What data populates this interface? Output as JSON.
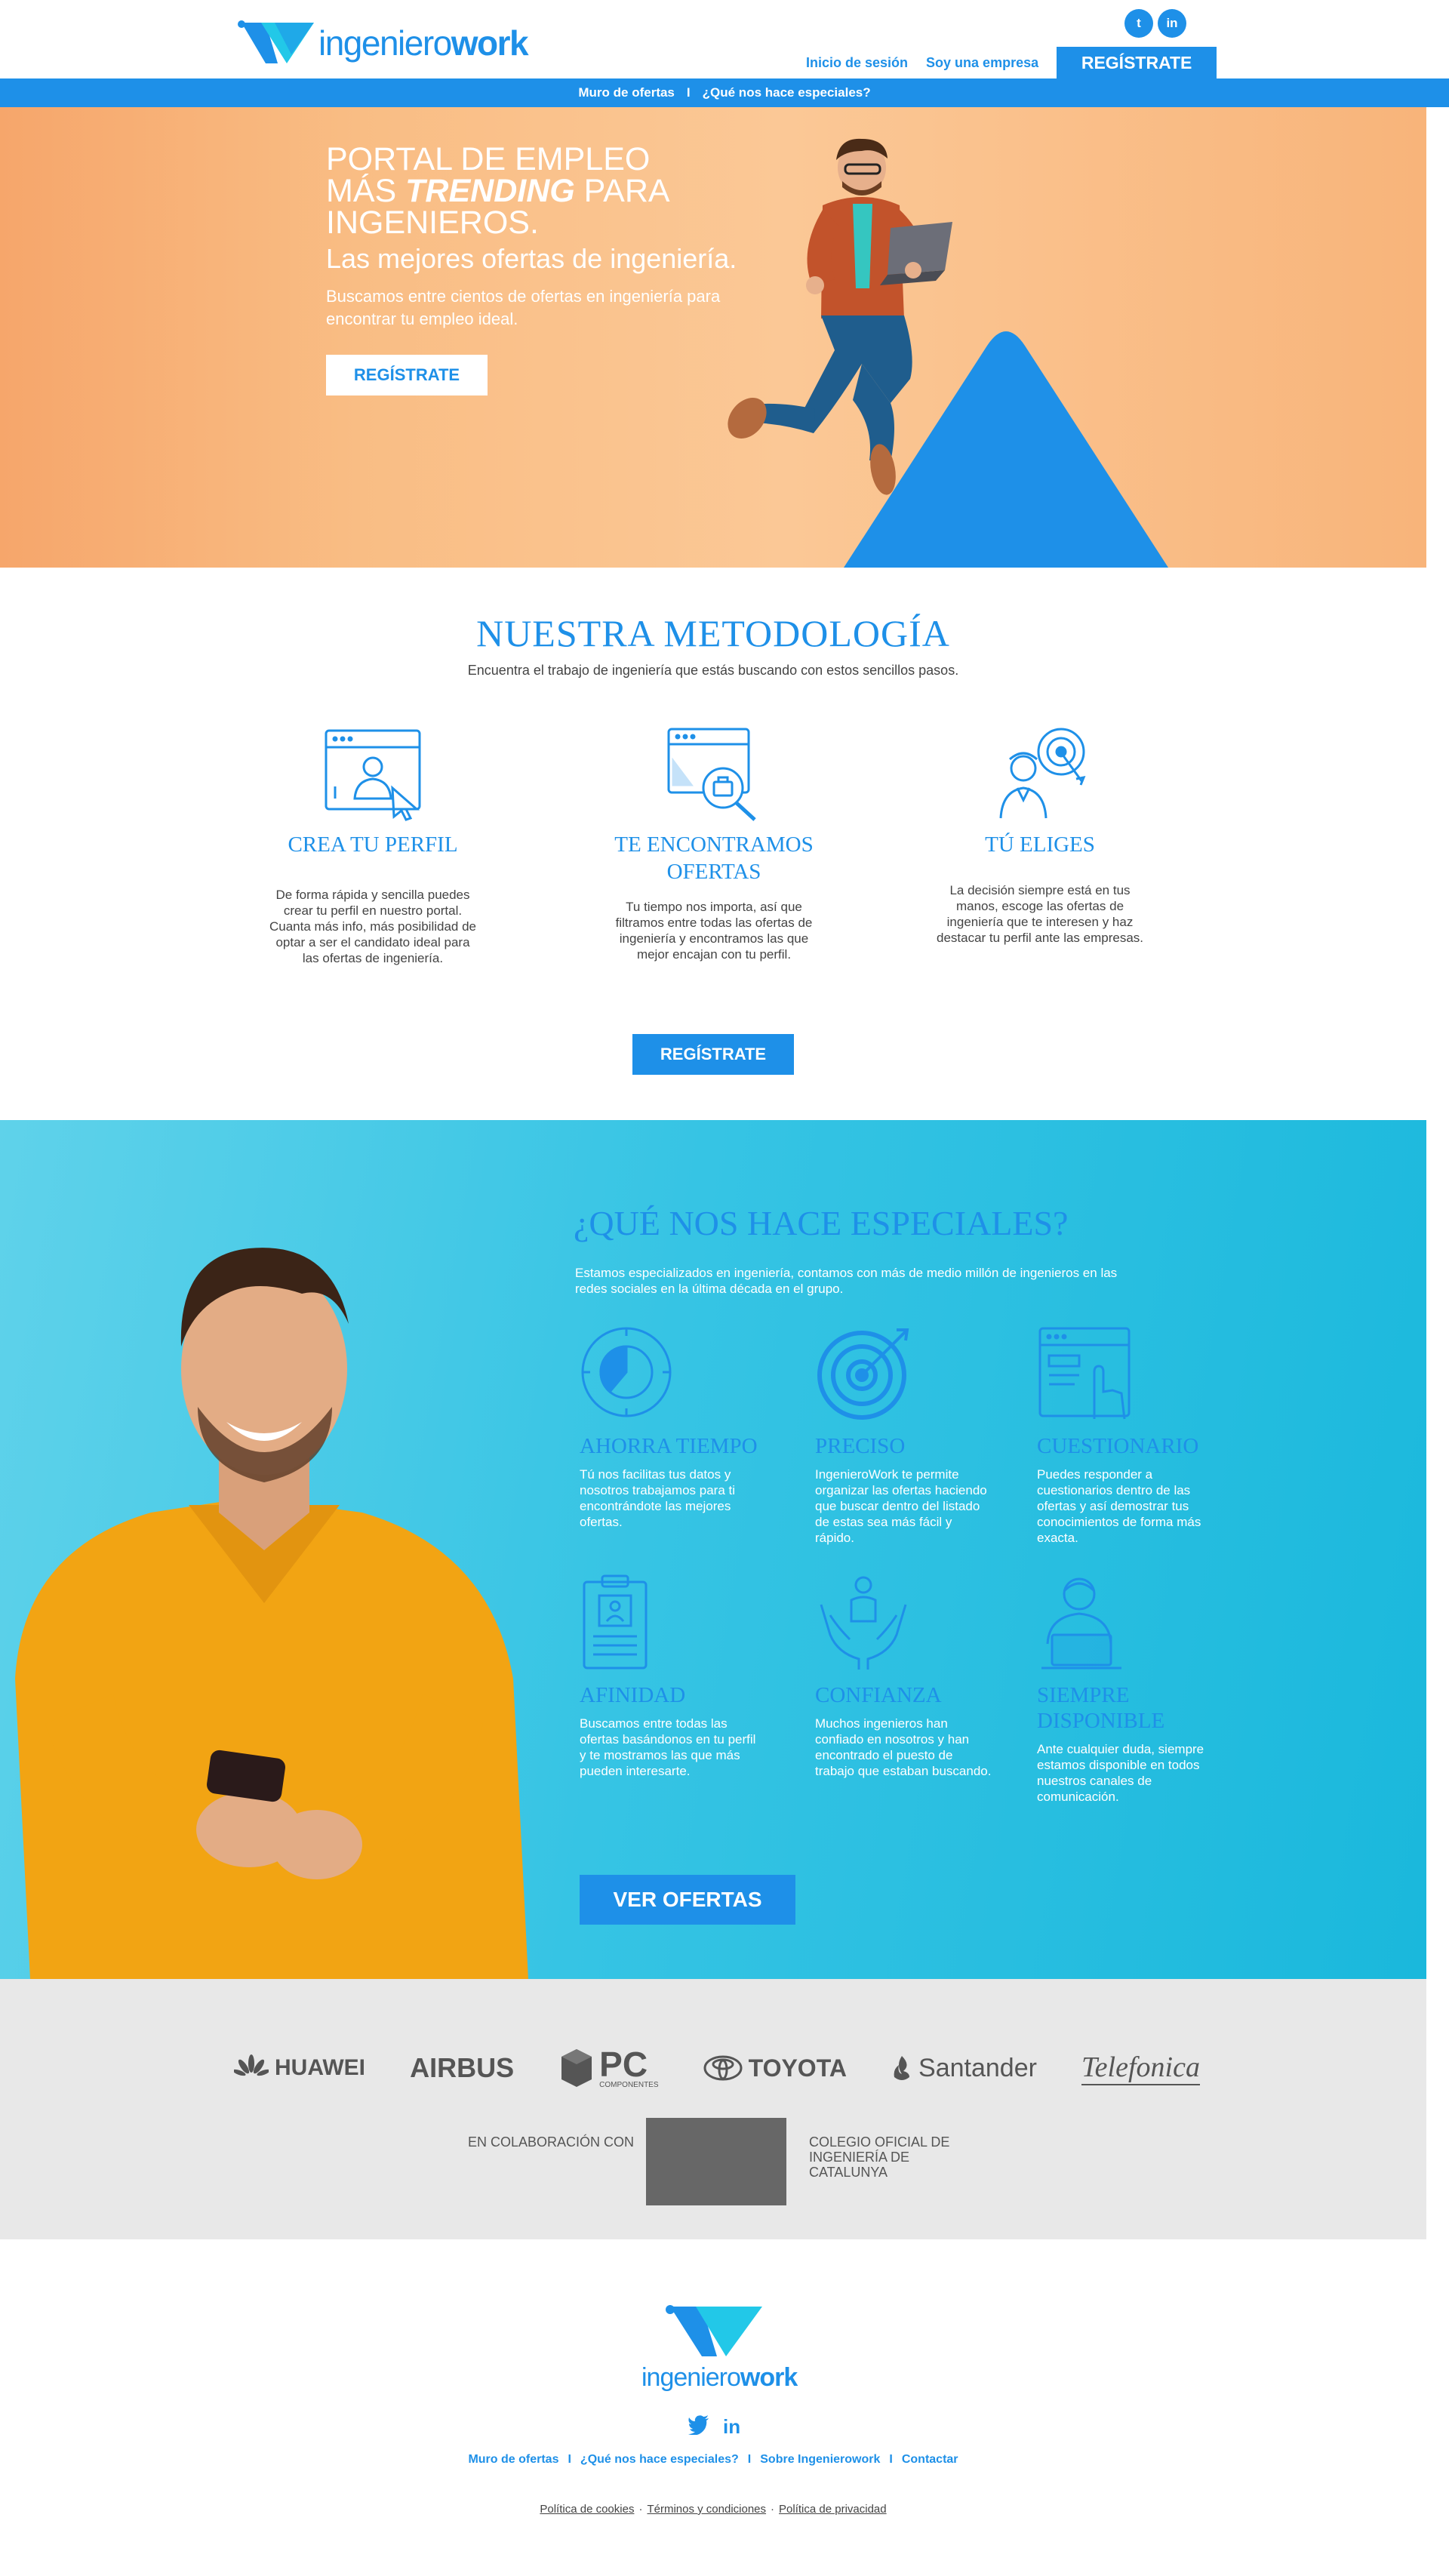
{
  "header": {
    "logo_text_light": "ingeniero",
    "logo_text_bold": "work",
    "social": [
      {
        "icon": "twitter-icon",
        "glyph": "t"
      },
      {
        "icon": "linkedin-icon",
        "glyph": "in"
      }
    ],
    "login_label": "Inicio de sesión",
    "company_label": "Soy una empresa",
    "register_label": "REGÍSTRATE"
  },
  "subnav": {
    "items": [
      "Muro de ofertas",
      "¿Qué nos hace especiales?"
    ],
    "separator": "I"
  },
  "hero": {
    "title_line1": "PORTAL DE EMPLEO",
    "title_line2_pre": "MÁS ",
    "title_line2_em": "TRENDING",
    "title_line2_post": " PARA",
    "title_line3": "INGENIEROS.",
    "subtitle": "Las mejores ofertas de ingeniería.",
    "description": "Buscamos entre cientos de ofertas en ingeniería para encontrar tu empleo ideal.",
    "button": "REGÍSTRATE"
  },
  "methodology": {
    "title": "NUESTRA METODOLOGÍA",
    "subtitle": "Encuentra el trabajo de ingeniería que estás buscando con estos sencillos pasos.",
    "steps": [
      {
        "icon": "profile-window-icon",
        "title": "CREA TU PERFIL",
        "text": "De forma rápida y sencilla puedes crear tu perfil en nuestro portal. Cuanta más info, más posibilidad de optar a ser el candidato ideal para las ofertas de ingeniería."
      },
      {
        "icon": "search-job-icon",
        "title": "TE ENCONTRAMOS OFERTAS",
        "text": "Tu tiempo nos importa, así que filtramos entre todas las ofertas de ingeniería y encontramos las que mejor encajan con tu perfil."
      },
      {
        "icon": "choose-target-icon",
        "title": "TÚ ELIGES",
        "text": "La decisión siempre está en tus manos, escoge las ofertas de ingeniería que te interesen y haz destacar tu perfil ante las empresas."
      }
    ],
    "button": "REGÍSTRATE"
  },
  "special": {
    "title": "¿QUÉ NOS HACE ESPECIALES?",
    "subtitle": "Estamos especializados en ingeniería, contamos con más de medio millón de ingenieros en las redes sociales en la última década en el grupo.",
    "features": [
      {
        "icon": "stopwatch-icon",
        "title": "AHORRA TIEMPO",
        "text": "Tú nos facilitas tus datos y nosotros trabajamos para ti encontrándote las mejores ofertas."
      },
      {
        "icon": "target-icon",
        "title": "PRECISO",
        "text": "IngenieroWork te permite organizar las ofertas haciendo que buscar dentro del listado de estas sea más fácil y rápido."
      },
      {
        "icon": "questionnaire-icon",
        "title": "CUESTIONARIO",
        "text": "Puedes responder a cuestionarios dentro de las ofertas y así demostrar tus conocimientos de forma más exacta."
      },
      {
        "icon": "clipboard-profile-icon",
        "title": "AFINIDAD",
        "text": "Buscamos entre todas las ofertas basándonos en tu perfil y te mostramos las que más pueden interesarte."
      },
      {
        "icon": "hands-person-icon",
        "title": "CONFIANZA",
        "text": "Muchos ingenieros han confiado en nosotros y han encontrado el puesto de trabajo que estaban buscando."
      },
      {
        "icon": "support-agent-icon",
        "title": "SIEMPRE DISPONIBLE",
        "text": "Ante cualquier duda, siempre estamos disponible en todos nuestros canales de comunicación."
      }
    ],
    "button": "VER OFERTAS"
  },
  "brands": {
    "logos": [
      "HUAWEI",
      "AIRBUS",
      "PC",
      "TOYOTA",
      "Santander",
      "Telefonica"
    ],
    "pc_sub": "COMPONENTES",
    "collab_left": "EN COLABORACIÓN CON",
    "collab_right": "COLEGIO OFICIAL DE INGENIERÍA DE CATALUNYA"
  },
  "footer": {
    "logo_text_light": "ingeniero",
    "logo_text_bold": "work",
    "nav": [
      "Muro de ofertas",
      "¿Qué nos hace especiales?",
      "Sobre Ingenierowork",
      "Contactar"
    ],
    "separator": "I",
    "legal": [
      "Política de cookies",
      "Términos y condiciones",
      "Política de privacidad"
    ],
    "legal_separator": "·"
  },
  "colors": {
    "accent": "#1e90e8",
    "hero_bg": "#f9bd84",
    "special_bg": "#36c4e4",
    "brands_bg": "#e8e8e8"
  }
}
